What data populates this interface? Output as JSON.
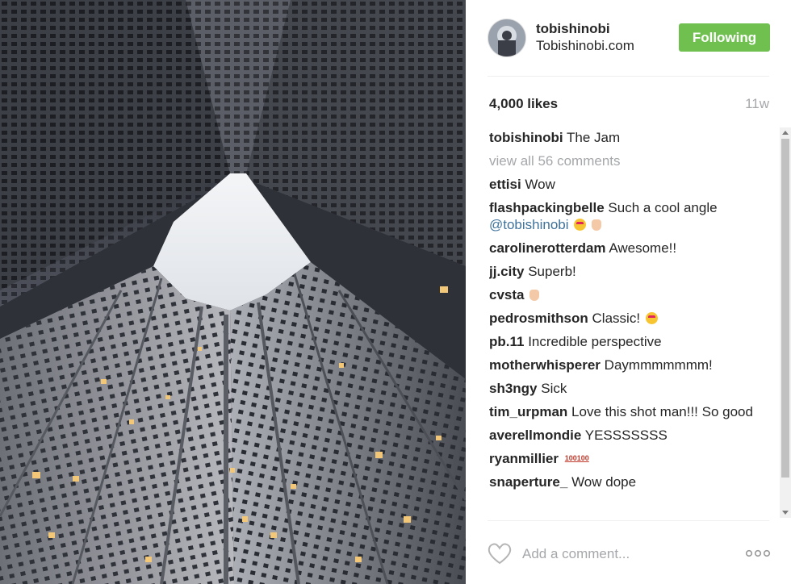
{
  "post": {
    "username": "tobishinobi",
    "website": "Tobishinobi.com",
    "follow_label": "Following",
    "likes": "4,000 likes",
    "time": "11w",
    "caption": {
      "user": "tobishinobi",
      "text": "The Jam"
    },
    "view_all": "view all 56 comments",
    "comments": [
      {
        "user": "ettisi",
        "text": "Wow"
      },
      {
        "user": "flashpackingbelle",
        "text": "Such a cool angle",
        "mention": "@tobishinobi",
        "emoji": [
          "heart-eyes",
          "wave"
        ]
      },
      {
        "user": "carolinerotterdam",
        "text": "Awesome!!"
      },
      {
        "user": "jj.city",
        "text": "Superb!"
      },
      {
        "user": "cvsta",
        "text": "",
        "emoji": [
          "point"
        ]
      },
      {
        "user": "pedrosmithson",
        "text": "Classic!",
        "emoji": [
          "heart-eyes"
        ]
      },
      {
        "user": "pb.11",
        "text": "Incredible perspective"
      },
      {
        "user": "motherwhisperer",
        "text": "Daymmmmmmm!"
      },
      {
        "user": "sh3ngy",
        "text": "Sick"
      },
      {
        "user": "tim_urpman",
        "text": "Love this shot man!!! So good"
      },
      {
        "user": "averellmondie",
        "text": "YESSSSSSS"
      },
      {
        "user": "ryanmillier",
        "text": "",
        "emoji_text": "100100"
      },
      {
        "user": "snaperture_",
        "text": "Wow dope"
      }
    ],
    "comment_placeholder": "Add a comment..."
  },
  "icons": {
    "like": "heart-outline-icon",
    "more": "more-dots-icon",
    "avatar": "avatar-image"
  },
  "colors": {
    "follow_button": "#70c050",
    "muted_text": "#a5a7aa",
    "mention": "#3f729b"
  }
}
